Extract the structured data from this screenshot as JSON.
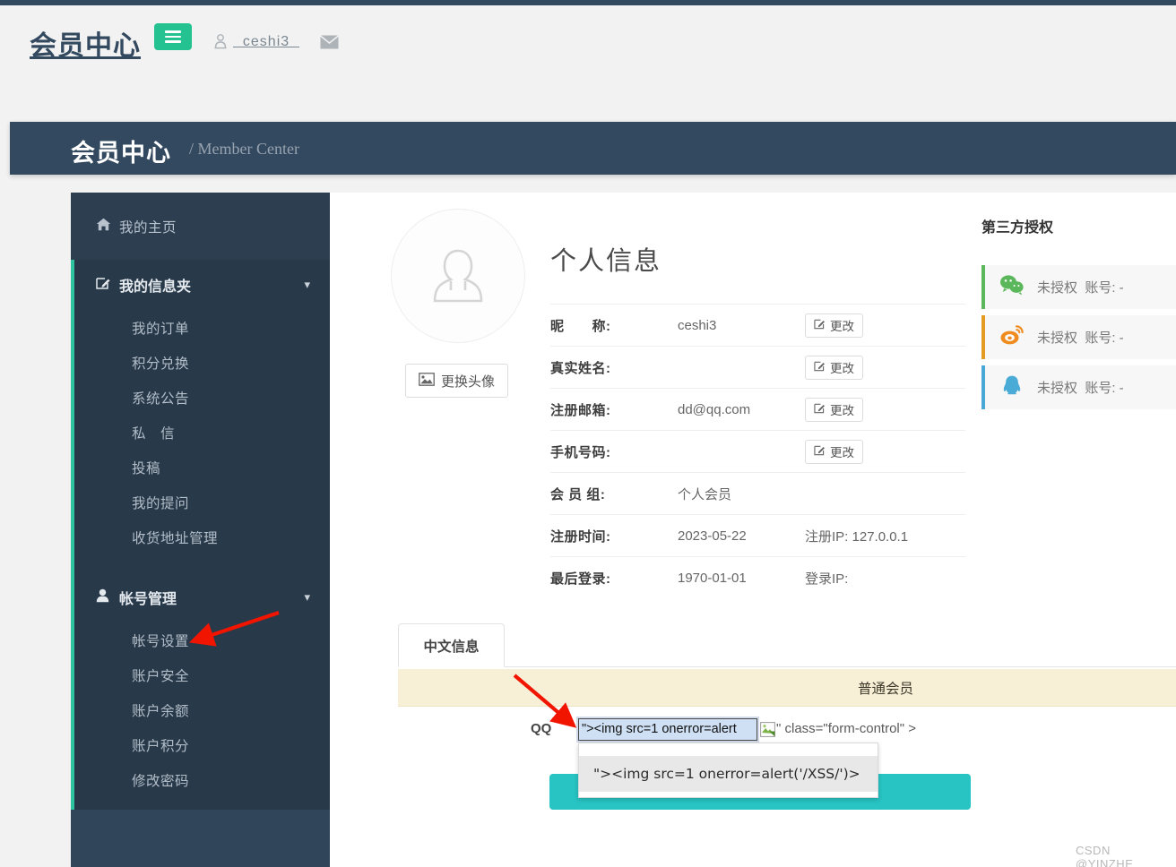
{
  "navbar": {
    "brand": "会员中心",
    "menu_icon": "hamburger-icon",
    "user_icon": "user-icon",
    "username": "  ceshi3  ",
    "mail_icon": "envelope-icon",
    "menu_button_color": "#25c291"
  },
  "page_header": {
    "title_cn": "会员中心",
    "title_en": "/ Member Center",
    "band_color": "#33495f"
  },
  "sidebar": {
    "accent_color": "#2ec4a0",
    "background": "#2c3e50",
    "home": {
      "label": "我的主页",
      "icon": "home-icon"
    },
    "groups": [
      {
        "label": "我的信息夹",
        "icon": "edit-square-icon",
        "chevron": "chevron-down-icon",
        "items": [
          "我的订单",
          "积分兑换",
          "系统公告",
          "私　信",
          "投稿",
          "我的提问",
          "收货地址管理"
        ]
      },
      {
        "label": "帐号管理",
        "icon": "user-solid-icon",
        "chevron": "chevron-down-icon",
        "items": [
          "帐号设置",
          "账户安全",
          "账户余额",
          "账户积分",
          "修改密码"
        ]
      }
    ]
  },
  "profile": {
    "avatar_icon": "default-user-avatar",
    "change_avatar_label": "更换头像",
    "change_avatar_icon": "image-icon",
    "title": "个人信息",
    "edit_label": "更改",
    "edit_icon": "pencil-square-icon",
    "rows": [
      {
        "label": "昵　　称:",
        "value": "ceshi3",
        "extra": "",
        "editable": true
      },
      {
        "label": "真实姓名:",
        "value": "",
        "extra": "",
        "editable": true
      },
      {
        "label": "注册邮箱:",
        "value": "dd@qq.com",
        "extra": "",
        "editable": true
      },
      {
        "label": "手机号码:",
        "value": "",
        "extra": "",
        "editable": true
      },
      {
        "label": "会 员 组:",
        "value": "个人会员",
        "extra": "",
        "editable": false
      },
      {
        "label": "注册时间:",
        "value": "2023-05-22",
        "extra": "注册IP: 127.0.0.1",
        "editable": false
      },
      {
        "label": "最后登录:",
        "value": "1970-01-01",
        "extra": "登录IP:",
        "editable": false
      }
    ]
  },
  "third_party": {
    "title": "第三方授权",
    "items": [
      {
        "icon": "wechat-icon",
        "accent": "#5cb85c",
        "text": "未授权  账号: -"
      },
      {
        "icon": "weibo-icon",
        "accent": "#e59a20",
        "text": "未授权  账号: -"
      },
      {
        "icon": "qq-icon",
        "accent": "#4aa8d8",
        "text": "未授权  账号: -"
      }
    ]
  },
  "tabs": {
    "active": "中文信息"
  },
  "member_band": {
    "text": "普通会员",
    "background": "#f7f0d7"
  },
  "xss_form": {
    "field_label": "QQ",
    "input_value": "\"><img src=1 onerror=alert",
    "broken_image_icon": "broken-image-icon",
    "tail_text": "\" class=\"form-control\" >",
    "suggestion": "\"><img src=1 onerror=alert('/XSS/')>",
    "submit_color": "#28c3c3"
  },
  "annotations": {
    "arrow_color": "#f11500",
    "arrow_count": 2
  },
  "watermark": "CSDN @YINZHE_"
}
